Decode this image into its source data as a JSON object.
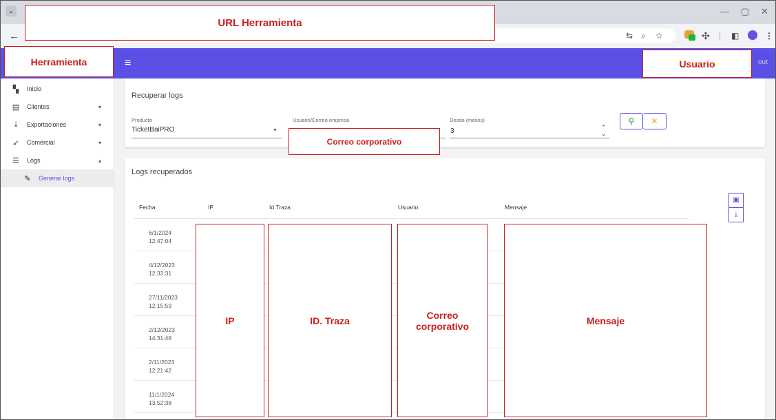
{
  "browser": {
    "tab_menu_icon": "chevron-down-icon",
    "back_icon": "back-arrow-icon",
    "window_controls": [
      "—",
      "▢",
      "✕"
    ],
    "omnibox_icons": [
      "translate-icon",
      "zoom-icon",
      "star-icon"
    ],
    "toolbar_icons": [
      "puzzle-icon",
      "sidepanel-icon",
      "menu-icon"
    ]
  },
  "annotations": {
    "url": "URL Herramienta",
    "tool": "Herramienta",
    "user": "Usuario",
    "email_field": "Correo corporativo",
    "col_ip": "IP",
    "col_trace": "ID. Traza",
    "col_user": "Correo corporativo",
    "col_message": "Mensaje"
  },
  "header": {
    "logout_label": "out"
  },
  "sidebar": {
    "items": [
      {
        "label": "Inicio",
        "icon": "dashboard-icon"
      },
      {
        "label": "Clientes",
        "icon": "building-icon",
        "expand": "▾"
      },
      {
        "label": "Exportaciones",
        "icon": "download-icon",
        "expand": "▾"
      },
      {
        "label": "Comercial",
        "icon": "rocket-icon",
        "expand": "▾"
      },
      {
        "label": "Logs",
        "icon": "list-icon",
        "expand": "▴"
      },
      {
        "label": "Generar logs",
        "icon": "pencil-icon"
      }
    ]
  },
  "search": {
    "title": "Recuperar logs",
    "product_label": "Producto",
    "product_value": "TicketBaiPRO",
    "user_label": "Usuario/Correo empresa",
    "since_label": "Desde (meses)",
    "since_value": "3"
  },
  "results": {
    "title": "Logs recuperados",
    "columns": [
      "Fecha",
      "IP",
      "Id.Traza",
      "Usuario",
      "Mensaje"
    ],
    "rows": [
      {
        "date": "6/1/2024",
        "time": "12:47:04"
      },
      {
        "date": "4/12/2023",
        "time": "12:33:31"
      },
      {
        "date": "27/11/2023",
        "time": "12:15:59"
      },
      {
        "date": "2/12/2023",
        "time": "14:31:48"
      },
      {
        "date": "2/11/2023",
        "time": "12:21:42"
      },
      {
        "date": "11/1/2024",
        "time": "13:52:38"
      }
    ]
  },
  "colors": {
    "primary": "#5a50e6",
    "annotation": "#c81e1e"
  }
}
